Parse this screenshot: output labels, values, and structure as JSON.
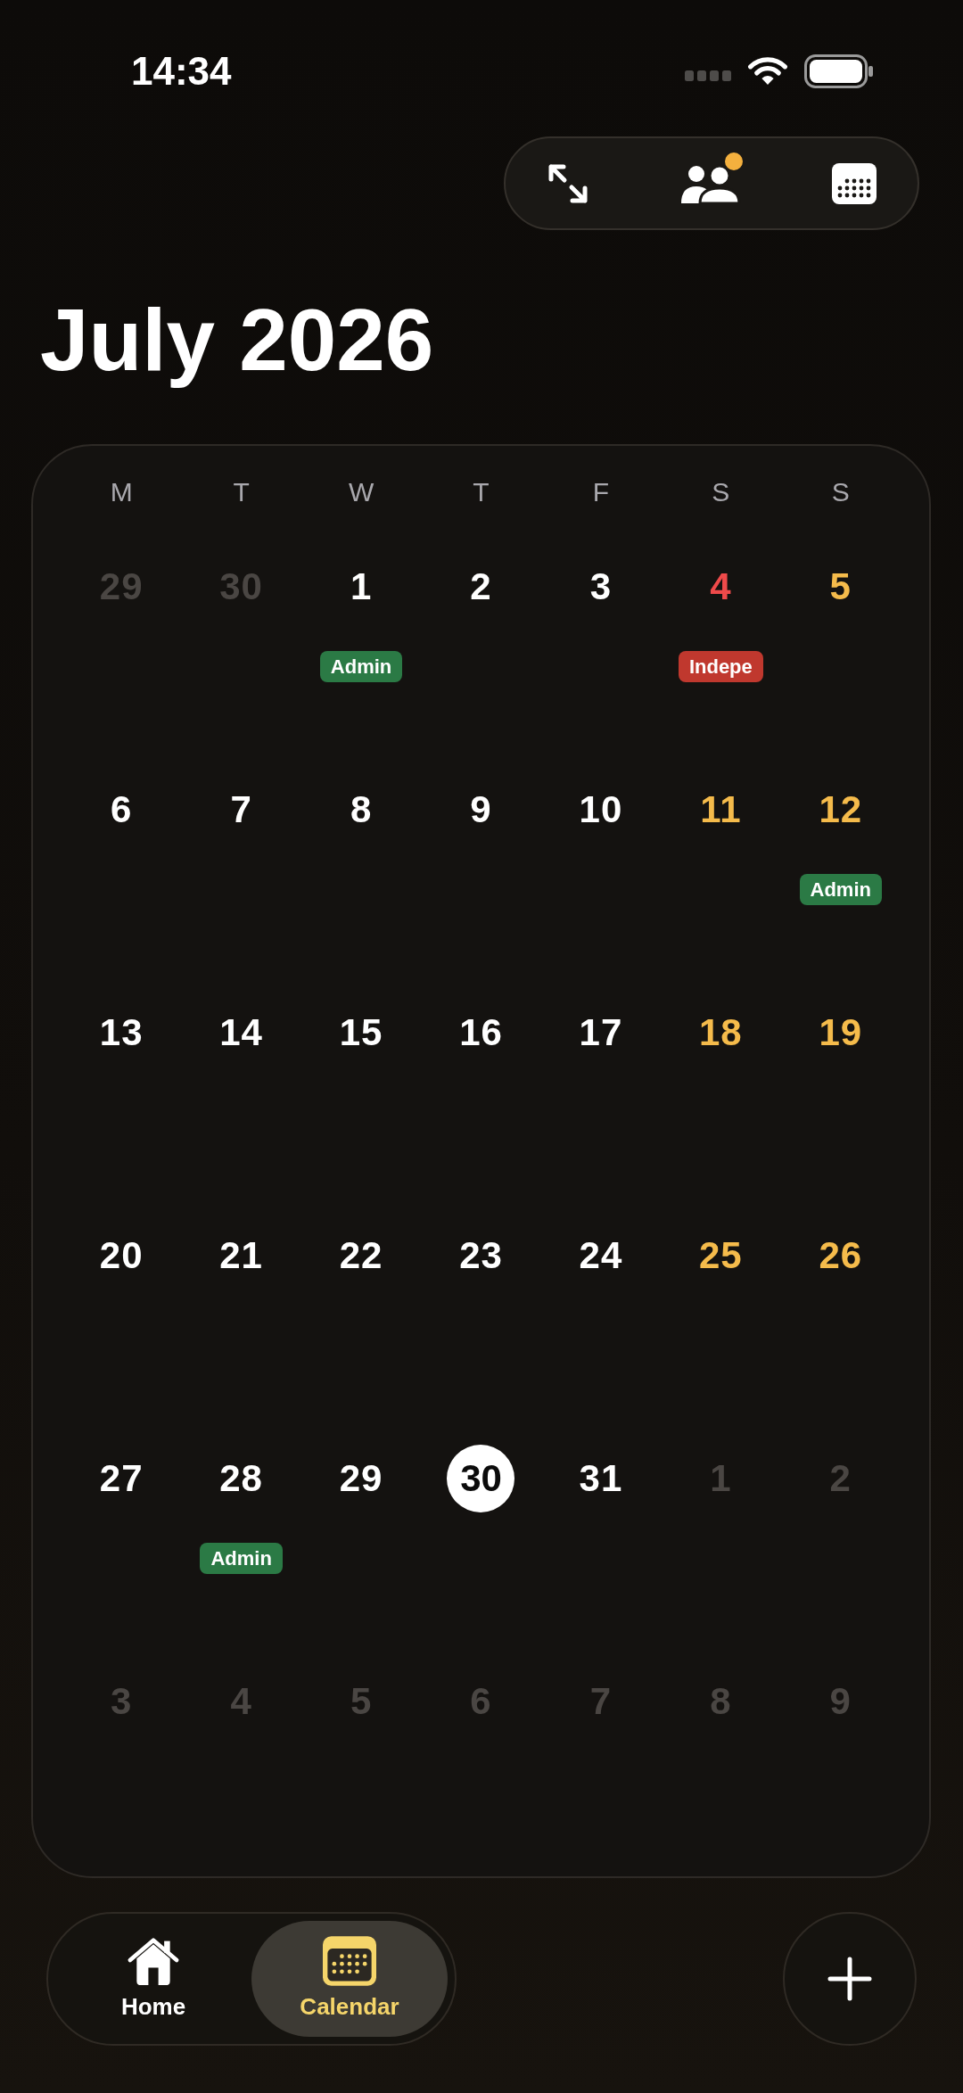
{
  "status_bar": {
    "time": "14:34"
  },
  "toolbar": {
    "notification": true
  },
  "title": "July 2026",
  "calendar": {
    "weekdays": [
      "M",
      "T",
      "W",
      "T",
      "F",
      "S",
      "S"
    ],
    "weeks": [
      [
        {
          "day": "29",
          "kind": "outside",
          "selected": false
        },
        {
          "day": "30",
          "kind": "outside",
          "selected": false
        },
        {
          "day": "1",
          "kind": "weekday",
          "selected": false,
          "events": [
            {
              "label": "Admin",
              "color": "#2b7a45"
            }
          ]
        },
        {
          "day": "2",
          "kind": "weekday",
          "selected": false
        },
        {
          "day": "3",
          "kind": "weekday",
          "selected": false
        },
        {
          "day": "4",
          "kind": "holiday",
          "selected": false,
          "events": [
            {
              "label": "Indepe",
              "color": "#c0382e"
            }
          ]
        },
        {
          "day": "5",
          "kind": "weekend",
          "selected": false
        }
      ],
      [
        {
          "day": "6",
          "kind": "weekday",
          "selected": false
        },
        {
          "day": "7",
          "kind": "weekday",
          "selected": false
        },
        {
          "day": "8",
          "kind": "weekday",
          "selected": false
        },
        {
          "day": "9",
          "kind": "weekday",
          "selected": false
        },
        {
          "day": "10",
          "kind": "weekday",
          "selected": false
        },
        {
          "day": "11",
          "kind": "weekend",
          "selected": false
        },
        {
          "day": "12",
          "kind": "weekend",
          "selected": false,
          "events": [
            {
              "label": "Admin",
              "color": "#2b7a45"
            }
          ]
        }
      ],
      [
        {
          "day": "13",
          "kind": "weekday",
          "selected": false
        },
        {
          "day": "14",
          "kind": "weekday",
          "selected": false
        },
        {
          "day": "15",
          "kind": "weekday",
          "selected": false
        },
        {
          "day": "16",
          "kind": "weekday",
          "selected": false
        },
        {
          "day": "17",
          "kind": "weekday",
          "selected": false
        },
        {
          "day": "18",
          "kind": "weekend",
          "selected": false
        },
        {
          "day": "19",
          "kind": "weekend",
          "selected": false
        }
      ],
      [
        {
          "day": "20",
          "kind": "weekday",
          "selected": false
        },
        {
          "day": "21",
          "kind": "weekday",
          "selected": false
        },
        {
          "day": "22",
          "kind": "weekday",
          "selected": false
        },
        {
          "day": "23",
          "kind": "weekday",
          "selected": false
        },
        {
          "day": "24",
          "kind": "weekday",
          "selected": false
        },
        {
          "day": "25",
          "kind": "weekend",
          "selected": false
        },
        {
          "day": "26",
          "kind": "weekend",
          "selected": false
        }
      ],
      [
        {
          "day": "27",
          "kind": "weekday",
          "selected": false
        },
        {
          "day": "28",
          "kind": "weekday",
          "selected": false,
          "events": [
            {
              "label": "Admin",
              "color": "#2b7a45"
            }
          ]
        },
        {
          "day": "29",
          "kind": "weekday",
          "selected": false
        },
        {
          "day": "30",
          "kind": "weekday",
          "selected": true
        },
        {
          "day": "31",
          "kind": "weekday",
          "selected": false
        },
        {
          "day": "1",
          "kind": "outside",
          "selected": false
        },
        {
          "day": "2",
          "kind": "outside",
          "selected": false
        }
      ],
      [
        {
          "day": "3",
          "kind": "outside",
          "selected": false
        },
        {
          "day": "4",
          "kind": "outside",
          "selected": false
        },
        {
          "day": "5",
          "kind": "outside",
          "selected": false
        },
        {
          "day": "6",
          "kind": "outside",
          "selected": false
        },
        {
          "day": "7",
          "kind": "outside",
          "selected": false
        },
        {
          "day": "8",
          "kind": "outside",
          "selected": false
        },
        {
          "day": "9",
          "kind": "outside",
          "selected": false
        }
      ]
    ]
  },
  "tabs": [
    {
      "label": "Home",
      "selected": false
    },
    {
      "label": "Calendar",
      "selected": true
    }
  ]
}
